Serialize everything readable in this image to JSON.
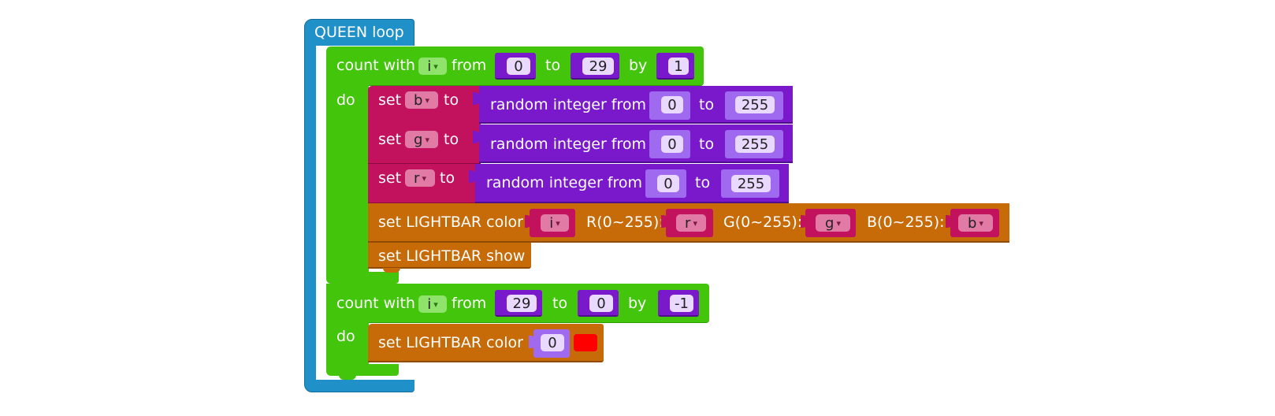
{
  "colors": {
    "loop": "#2090c8",
    "control": "#42c50b",
    "control_edge": "#2f9a05",
    "variable": "#c2125e",
    "variable_field": "#e27aa6",
    "math": "#7a19cc",
    "math_edge": "#4f0c8f",
    "number_field": "#ead9ff",
    "lightbar": "#c66b08",
    "lightbar_edge": "#8f4b03",
    "swatch": "#ff0000"
  },
  "queen": {
    "label": "QUEEN loop"
  },
  "loop1": {
    "count_label": "count with",
    "var": "i",
    "from_label": "from",
    "from": "0",
    "to_label": "to",
    "to": "29",
    "by_label": "by",
    "by": "1",
    "do_label": "do"
  },
  "set_b": {
    "set_label": "set",
    "var": "b",
    "to_label": "to",
    "rand_label": "random integer from",
    "from": "0",
    "to_word": "to",
    "to": "255"
  },
  "set_g": {
    "set_label": "set",
    "var": "g",
    "to_label": "to",
    "rand_label": "random integer from",
    "from": "0",
    "to_word": "to",
    "to": "255"
  },
  "set_r": {
    "set_label": "set",
    "var": "r",
    "to_label": "to",
    "rand_label": "random integer from",
    "from": "0",
    "to_word": "to",
    "to": "255"
  },
  "lightbar1": {
    "label": "set LIGHTBAR color",
    "index": "i",
    "r_label": "R(0~255):",
    "r": "r",
    "g_label": "G(0~255):",
    "g": "g",
    "b_label": "B(0~255):",
    "b": "b"
  },
  "show": {
    "label": "set LIGHTBAR show"
  },
  "loop2": {
    "count_label": "count with",
    "var": "i",
    "from_label": "from",
    "from": "29",
    "to_label": "to",
    "to": "0",
    "by_label": "by",
    "by": "-1",
    "do_label": "do"
  },
  "lightbar2": {
    "label": "set LIGHTBAR color",
    "index": "0",
    "color_name": "red"
  },
  "arrow_glyph": "▾"
}
